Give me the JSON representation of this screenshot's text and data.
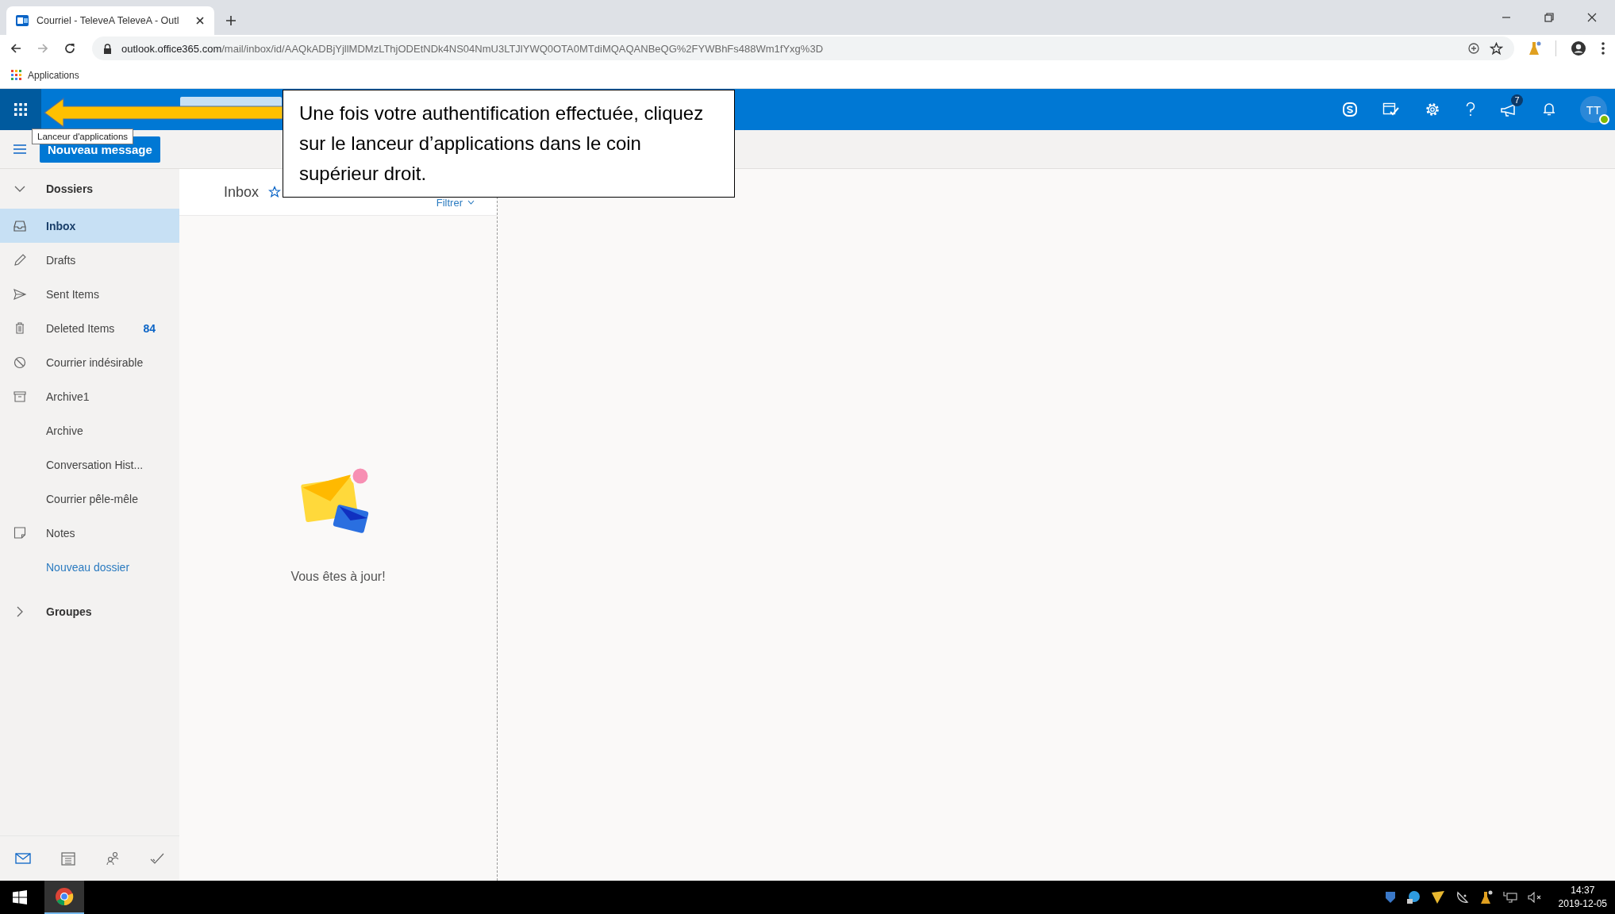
{
  "browser": {
    "tab_title": "Courriel - TeleveA TeleveA - Outl",
    "url_domain": "outlook.office365.com",
    "url_path": "/mail/inbox/id/AAQkADBjYjllMDMzLThjODEtNDk4NS04NmU3LTJlYWQ0OTA0MTdiMQAQANBeQG%2FYWBhFs488Wm1fYxg%3D",
    "bookmarks": [
      "Applications"
    ]
  },
  "header": {
    "app_launcher_tooltip": "Lanceur d'applications",
    "announcement_badge": "7",
    "avatar_initials": "TT",
    "new_message_button": "Nouveau message"
  },
  "folders": {
    "heading": "Dossiers",
    "expanded": true,
    "items": [
      {
        "kind": "inbox",
        "label": "Inbox",
        "selected": true
      },
      {
        "kind": "drafts",
        "label": "Drafts",
        "selected": false
      },
      {
        "kind": "sent",
        "label": "Sent Items",
        "selected": false
      },
      {
        "kind": "deleted",
        "label": "Deleted Items",
        "count": "84",
        "selected": false
      },
      {
        "kind": "junk",
        "label": "Courrier indésirable",
        "selected": false
      },
      {
        "kind": "archive",
        "label": "Archive1",
        "selected": false
      },
      {
        "kind": "plain",
        "label": "Archive",
        "selected": false
      },
      {
        "kind": "plain",
        "label": "Conversation Hist...",
        "selected": false
      },
      {
        "kind": "plain",
        "label": "Courrier pêle-mêle",
        "selected": false
      },
      {
        "kind": "notes",
        "label": "Notes",
        "selected": false
      }
    ],
    "new_folder_link": "Nouveau dossier",
    "groups_heading": "Groupes",
    "groups_expanded": false
  },
  "message_list": {
    "title": "Inbox",
    "filter": "Filtrer",
    "empty_message": "Vous êtes à jour!"
  },
  "bottom_nav": [
    {
      "kind": "mail",
      "selected": true
    },
    {
      "kind": "calendar",
      "selected": false
    },
    {
      "kind": "people",
      "selected": false
    },
    {
      "kind": "tasks",
      "selected": false
    }
  ],
  "callout": {
    "text": "Une fois votre authentification effectuée, cliquez sur le lanceur d’applications dans le coin supérieur droit."
  },
  "taskbar": {
    "time": "14:37",
    "date": "2019-12-05"
  }
}
